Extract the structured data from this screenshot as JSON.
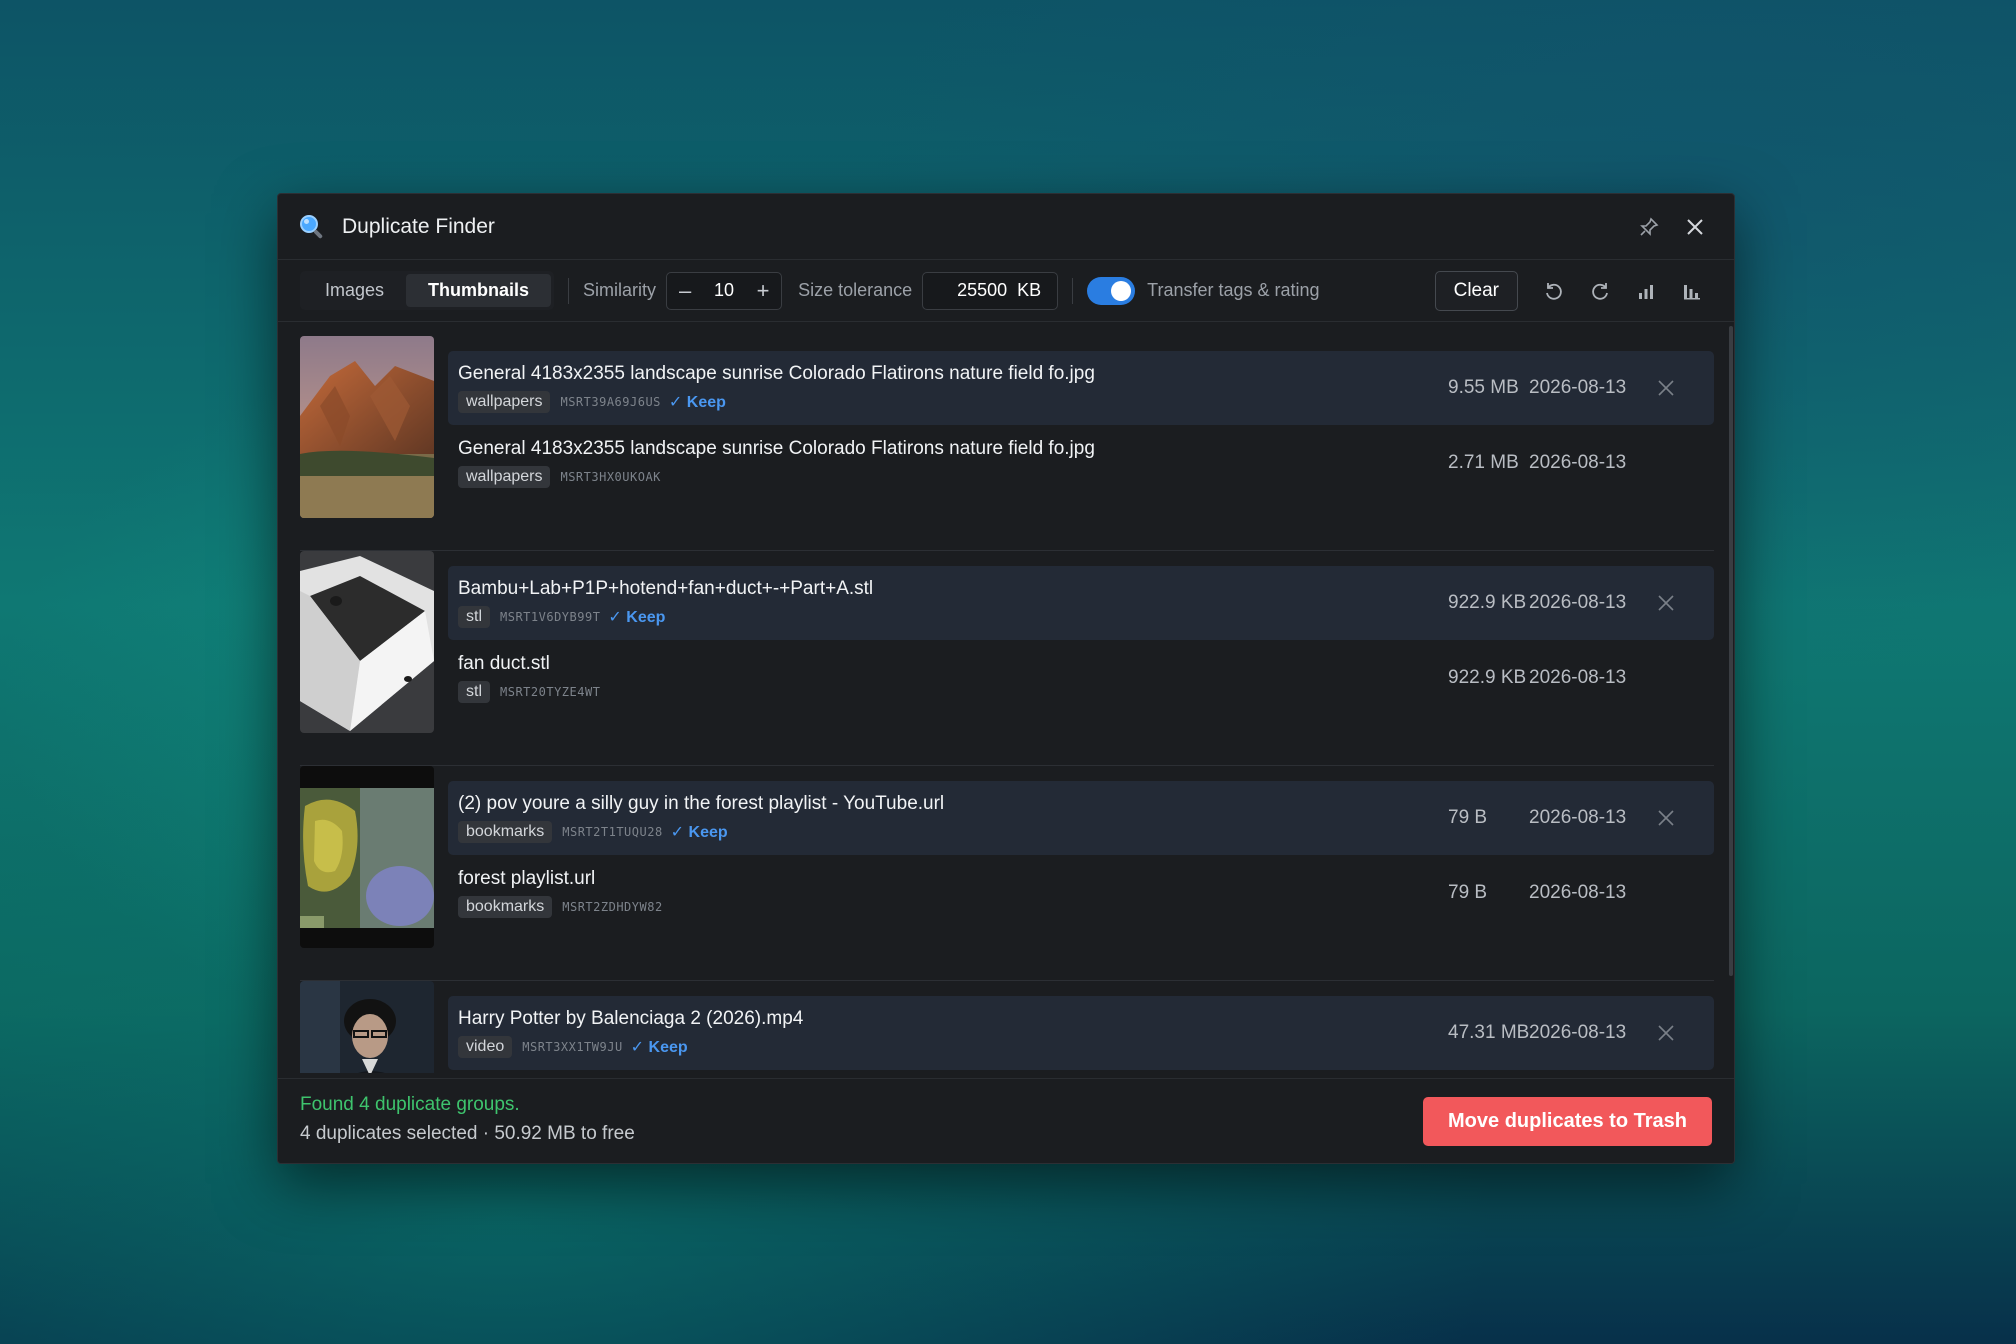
{
  "window": {
    "title": "Duplicate Finder"
  },
  "toolbar": {
    "tabs": [
      {
        "label": "Images",
        "active": false
      },
      {
        "label": "Thumbnails",
        "active": true
      }
    ],
    "similarity_label": "Similarity",
    "similarity_minus": "–",
    "similarity_value": "10",
    "similarity_plus": "+",
    "size_tolerance_label": "Size tolerance",
    "size_tolerance_value": "25500",
    "size_tolerance_unit": "KB",
    "transfer_toggle_on": true,
    "transfer_label": "Transfer tags & rating",
    "clear_label": "Clear",
    "icons": [
      "undo-icon",
      "redo-icon",
      "bar-chart-icon",
      "bar-chart-alt-icon"
    ]
  },
  "groups": [
    {
      "thumbnail": "mountain-landscape-thumbnail",
      "files": [
        {
          "name": "General 4183x2355 landscape sunrise Colorado Flatirons nature field fo.jpg",
          "tag": "wallpapers",
          "id": "MSRT39A69J6US",
          "keep": "✓ Keep",
          "size": "9.55 MB",
          "date": "2026-08-13"
        },
        {
          "name": "General 4183x2355 landscape sunrise Colorado Flatirons nature field fo.jpg",
          "tag": "wallpapers",
          "id": "MSRT3HX0UKOAK",
          "keep": "",
          "size": "2.71 MB",
          "date": "2026-08-13"
        }
      ]
    },
    {
      "thumbnail": "stl-model-thumbnail",
      "files": [
        {
          "name": "Bambu+Lab+P1P+hotend+fan+duct+-+Part+A.stl",
          "tag": "stl",
          "id": "MSRT1V6DYB99T",
          "keep": "✓ Keep",
          "size": "922.9 KB",
          "date": "2026-08-13"
        },
        {
          "name": "fan duct.stl",
          "tag": "stl",
          "id": "MSRT20TYZE4WT",
          "keep": "",
          "size": "922.9 KB",
          "date": "2026-08-13"
        }
      ]
    },
    {
      "thumbnail": "forest-playlist-thumbnail",
      "files": [
        {
          "name": "(2) pov youre a silly guy in the forest playlist - YouTube.url",
          "tag": "bookmarks",
          "id": "MSRT2T1TUQU28",
          "keep": "✓ Keep",
          "size": "79 B",
          "date": "2026-08-13"
        },
        {
          "name": "forest playlist.url",
          "tag": "bookmarks",
          "id": "MSRT2ZDHDYW82",
          "keep": "",
          "size": "79 B",
          "date": "2026-08-13"
        }
      ]
    },
    {
      "thumbnail": "video-portrait-thumbnail",
      "files": [
        {
          "name": "Harry Potter by Balenciaga 2 (2026).mp4",
          "tag": "video",
          "id": "MSRT3XX1TW9JU",
          "keep": "✓ Keep",
          "size": "47.31 MB",
          "date": "2026-08-13"
        }
      ]
    }
  ],
  "footer": {
    "status": "Found 4 duplicate groups.",
    "summary": "4 duplicates selected · 50.92 MB to free",
    "action_label": "Move duplicates to Trash"
  },
  "colors": {
    "accent": "#2a7de1",
    "keep": "#4a97f0",
    "danger": "#f2585b",
    "success": "#3ec46d"
  }
}
